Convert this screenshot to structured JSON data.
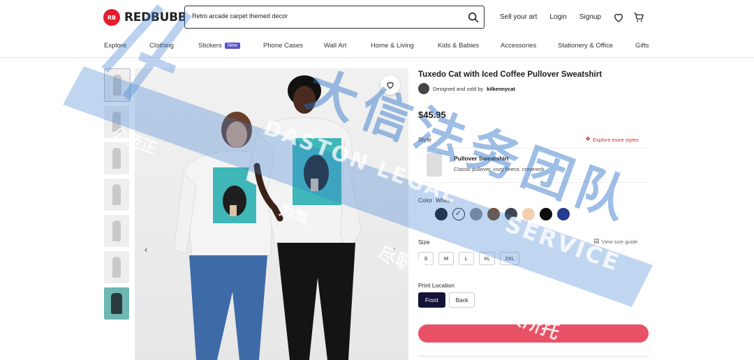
{
  "brand": {
    "name": "REDBUBBLE",
    "mark": "RB",
    "color": "#e41d2c"
  },
  "search": {
    "value": "Retro arcade carpet themed decor",
    "icon": "search-icon"
  },
  "top_links": {
    "sell": "Sell your art",
    "login": "Login",
    "signup": "Signup"
  },
  "nav": {
    "items": [
      "Explore",
      "Clothing",
      "Stickers",
      "Phone Cases",
      "Wall Art",
      "Home & Living",
      "Kids & Babies",
      "Accessories",
      "Stationery & Office",
      "Gifts"
    ],
    "stickers_badge": "New"
  },
  "product": {
    "title": "Tuxedo Cat with Iced Coffee Pullover Sweatshirt",
    "seller_prefix": "Designed and sold by",
    "seller": "kilkennycat",
    "price": "$45.95"
  },
  "style": {
    "label": "Style",
    "explore_link": "Explore more styles",
    "name": "Pullover Sweatshirt",
    "description": "Classic pullover, cozy fleece, crewneck"
  },
  "color": {
    "label": "Color",
    "selected": "White",
    "swatches": [
      "#161616",
      "#ffffff",
      "#8c8c8c",
      "#7a4a22",
      "#3c4550",
      "#f2cfae",
      "#0c0c0c",
      "#243b8f"
    ]
  },
  "size": {
    "label": "Size",
    "options": [
      "S",
      "M",
      "L",
      "XL",
      "2XL"
    ],
    "guide": "View size guide"
  },
  "print_location": {
    "label": "Print Location",
    "options": [
      "Front",
      "Back"
    ],
    "selected": "Front"
  },
  "watermark": {
    "cn_large": "大信法务团队",
    "cn_line1": "公至正",
    "cn_line2": "为笃",
    "cn_line3": "尽职尽责",
    "cn_line4": "不负所托",
    "en_line1": "DASTON LEGAL",
    "en_line2": "SERVICE"
  },
  "colors": {
    "accent": "#e95166",
    "button_dark": "#14133a",
    "badge": "#5a4fcf"
  }
}
